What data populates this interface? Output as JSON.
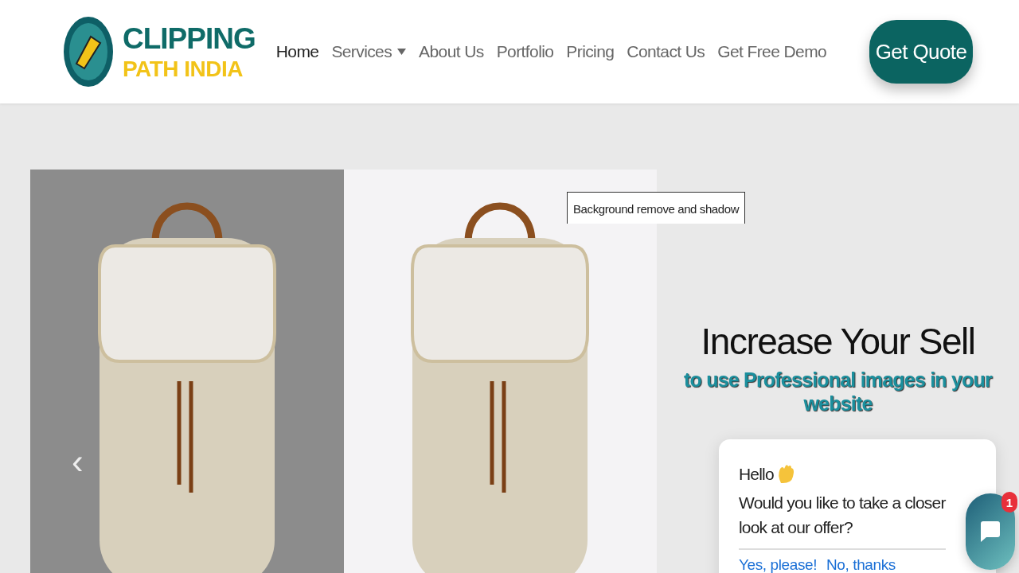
{
  "logo": {
    "line_1": "CLIPPING",
    "line_2": "PATH INDIA"
  },
  "nav": [
    {
      "label": "Home",
      "selected": true,
      "has_dropdown": false
    },
    {
      "label": "Services",
      "selected": false,
      "has_dropdown": true
    },
    {
      "label": "About Us",
      "selected": false,
      "has_dropdown": false
    },
    {
      "label": "Portfolio",
      "selected": false,
      "has_dropdown": false
    },
    {
      "label": "Pricing",
      "selected": false,
      "has_dropdown": false
    },
    {
      "label": "Contact Us",
      "selected": false,
      "has_dropdown": false
    },
    {
      "label": "Get Free Demo",
      "selected": false,
      "has_dropdown": false
    }
  ],
  "cta": "Get Quote",
  "slider": {
    "prev": "‹",
    "caption": "Background remove and shadow"
  },
  "hero": {
    "title": "Increase Your Sell",
    "subtitle": "to use Professional images in your website"
  },
  "chat": {
    "greeting": "Hello",
    "message": "Would you like to take a closer look at our offer?",
    "actions": [
      "Yes, please!",
      "No, thanks"
    ],
    "badge": "1"
  }
}
